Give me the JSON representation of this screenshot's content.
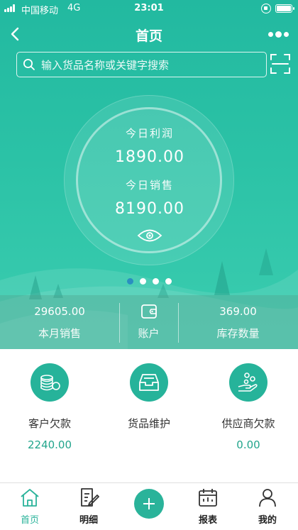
{
  "status_bar": {
    "carrier": "中国移动",
    "network": "4G",
    "time": "23:01"
  },
  "header": {
    "title": "首页"
  },
  "search": {
    "placeholder": "输入货品名称或关键字搜索"
  },
  "today": {
    "profit_label": "今日利润",
    "profit_value": "1890.00",
    "sales_label": "今日销售",
    "sales_value": "8190.00"
  },
  "carousel": {
    "page_count": 4,
    "active_index": 0
  },
  "summary": {
    "month_sales_value": "29605.00",
    "month_sales_label": "本月销售",
    "account_label": "账户",
    "stock_value": "369.00",
    "stock_label": "库存数量"
  },
  "quick": [
    {
      "label": "客户欠款",
      "value": "2240.00",
      "icon": "coins-icon"
    },
    {
      "label": "货品维护",
      "value": "",
      "icon": "inbox-icon"
    },
    {
      "label": "供应商欠款",
      "value": "0.00",
      "icon": "hand-coins-icon"
    }
  ],
  "tabs": [
    {
      "label": "首页",
      "icon": "home-icon"
    },
    {
      "label": "明细",
      "icon": "edit-doc-icon"
    },
    {
      "label": "",
      "icon": "plus-icon"
    },
    {
      "label": "报表",
      "icon": "calendar-icon"
    },
    {
      "label": "我的",
      "icon": "user-icon"
    }
  ],
  "colors": {
    "primary": "#26b39a",
    "accent_text": "#22a58c",
    "active_dot": "#2a8fc0"
  }
}
